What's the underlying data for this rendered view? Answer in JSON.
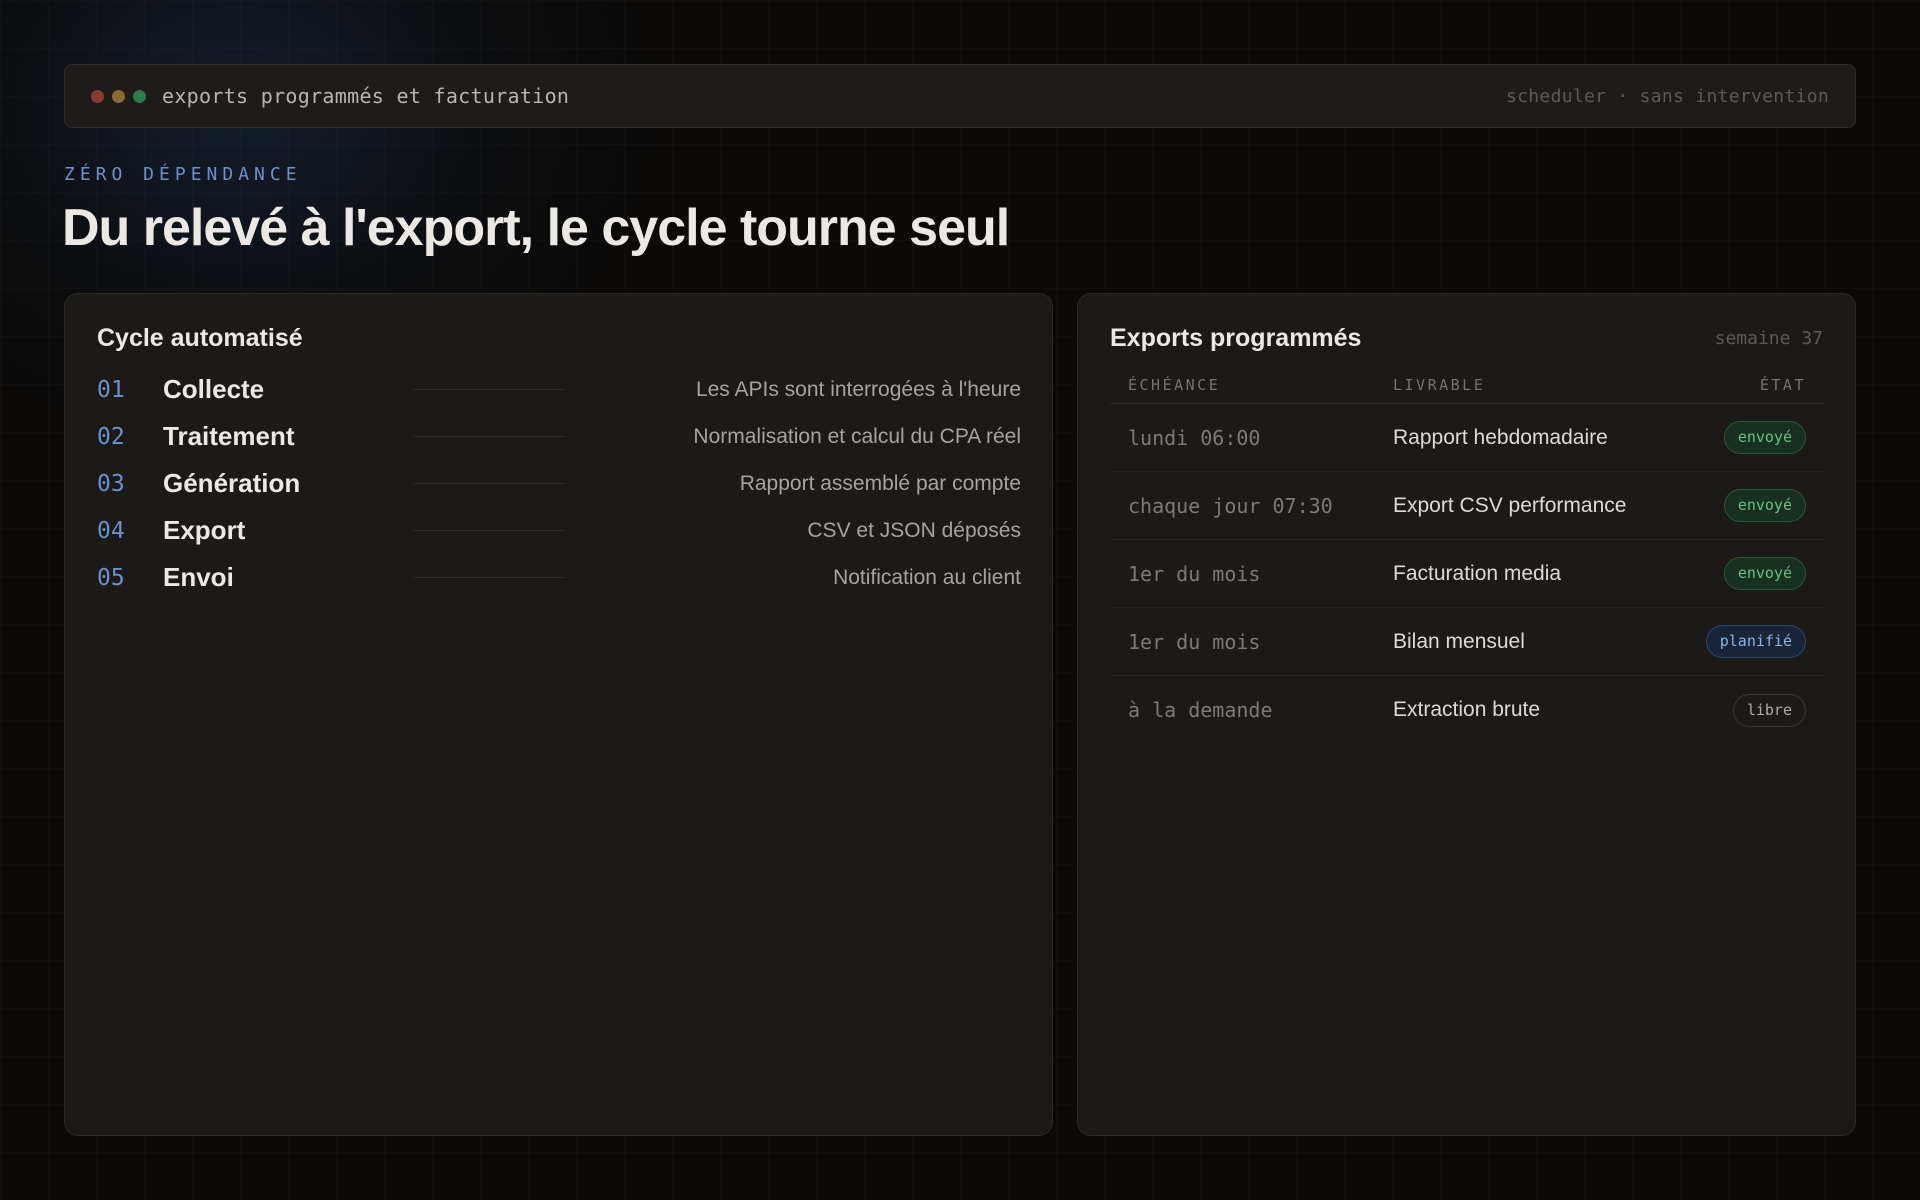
{
  "window": {
    "title": "exports programmés et facturation",
    "status": "scheduler · sans intervention"
  },
  "header": {
    "eyebrow": "ZÉRO DÉPENDANCE",
    "title": "Du relevé à l'export, le cycle tourne seul"
  },
  "cycle": {
    "title": "Cycle automatisé",
    "steps": [
      {
        "num": "01",
        "name": "Collecte",
        "desc": "Les APIs sont interrogées à l'heure"
      },
      {
        "num": "02",
        "name": "Traitement",
        "desc": "Normalisation et calcul du CPA réel"
      },
      {
        "num": "03",
        "name": "Génération",
        "desc": "Rapport assemblé par compte"
      },
      {
        "num": "04",
        "name": "Export",
        "desc": "CSV et JSON déposés"
      },
      {
        "num": "05",
        "name": "Envoi",
        "desc": "Notification au client"
      }
    ]
  },
  "exports": {
    "title": "Exports programmés",
    "week": "semaine 37",
    "columns": {
      "when": "ÉCHÉANCE",
      "what": "LIVRABLE",
      "state": "ÉTAT"
    },
    "rows": [
      {
        "when": "lundi 06:00",
        "what": "Rapport hebdomadaire",
        "state": "envoyé",
        "kind": "sent"
      },
      {
        "when": "chaque jour 07:30",
        "what": "Export CSV performance",
        "state": "envoyé",
        "kind": "sent"
      },
      {
        "when": "1er du mois",
        "what": "Facturation media",
        "state": "envoyé",
        "kind": "sent"
      },
      {
        "when": "1er du mois",
        "what": "Bilan mensuel",
        "state": "planifié",
        "kind": "planned"
      },
      {
        "when": "à la demande",
        "what": "Extraction brute",
        "state": "libre",
        "kind": "free"
      }
    ]
  },
  "colors": {
    "accent": "#6a90cf",
    "sent": "#68c083",
    "planned": "#8eb1e8",
    "free": "#b0aca6"
  }
}
